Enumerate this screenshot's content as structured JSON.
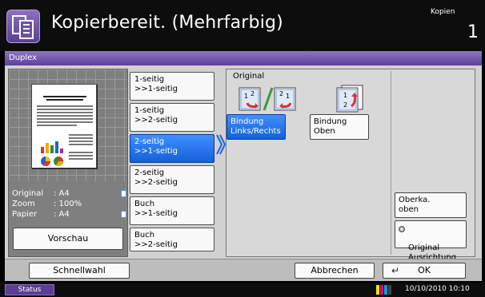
{
  "header": {
    "status_title": "Kopierbereit. (Mehrfarbig)",
    "copies_label": "Kopien",
    "copies_value": "1",
    "icon": "copy-document-icon"
  },
  "panel": {
    "title": "Duplex"
  },
  "preview": {
    "thumbnail_heading": "The Winning Game from Shoot Ahim and Inventor",
    "rows": [
      {
        "label": "Original",
        "value": ": A4"
      },
      {
        "label": "Zoom",
        "value": ": 100%"
      },
      {
        "label": "Papier",
        "value": ": A4"
      }
    ],
    "button_label": "Vorschau"
  },
  "modes": [
    {
      "label": "1-seitig\n>>1-seitig",
      "selected": false
    },
    {
      "label": "1-seitig\n>>2-seitig",
      "selected": false
    },
    {
      "label": "2-seitig\n>>1-seitig",
      "selected": true
    },
    {
      "label": "2-seitig\n>>2-seitig",
      "selected": false
    },
    {
      "label": "Buch\n>>1-seitig",
      "selected": false
    },
    {
      "label": "Buch\n>>2-seitig",
      "selected": false
    }
  ],
  "original": {
    "label": "Original",
    "binding_options": [
      {
        "label": "Bindung\nLinks/Rechts",
        "selected": true,
        "icon": "binding-left-right-icon"
      },
      {
        "label": "Bindung\nOben",
        "selected": false,
        "icon": "binding-top-icon"
      }
    ],
    "orientation_value": "Oberka.\noben",
    "orientation_button": "Original\nAusrichtung"
  },
  "actions": {
    "quick_setup": "Schnellwahl",
    "cancel": "Abbrechen",
    "ok": "OK"
  },
  "status_bar": {
    "status_label": "Status",
    "datetime": "10/10/2010  10:10"
  },
  "colors": {
    "accent_purple": "#5c3f99",
    "selected_blue": "#1460d9",
    "panel_gray": "#d1d1d1"
  }
}
